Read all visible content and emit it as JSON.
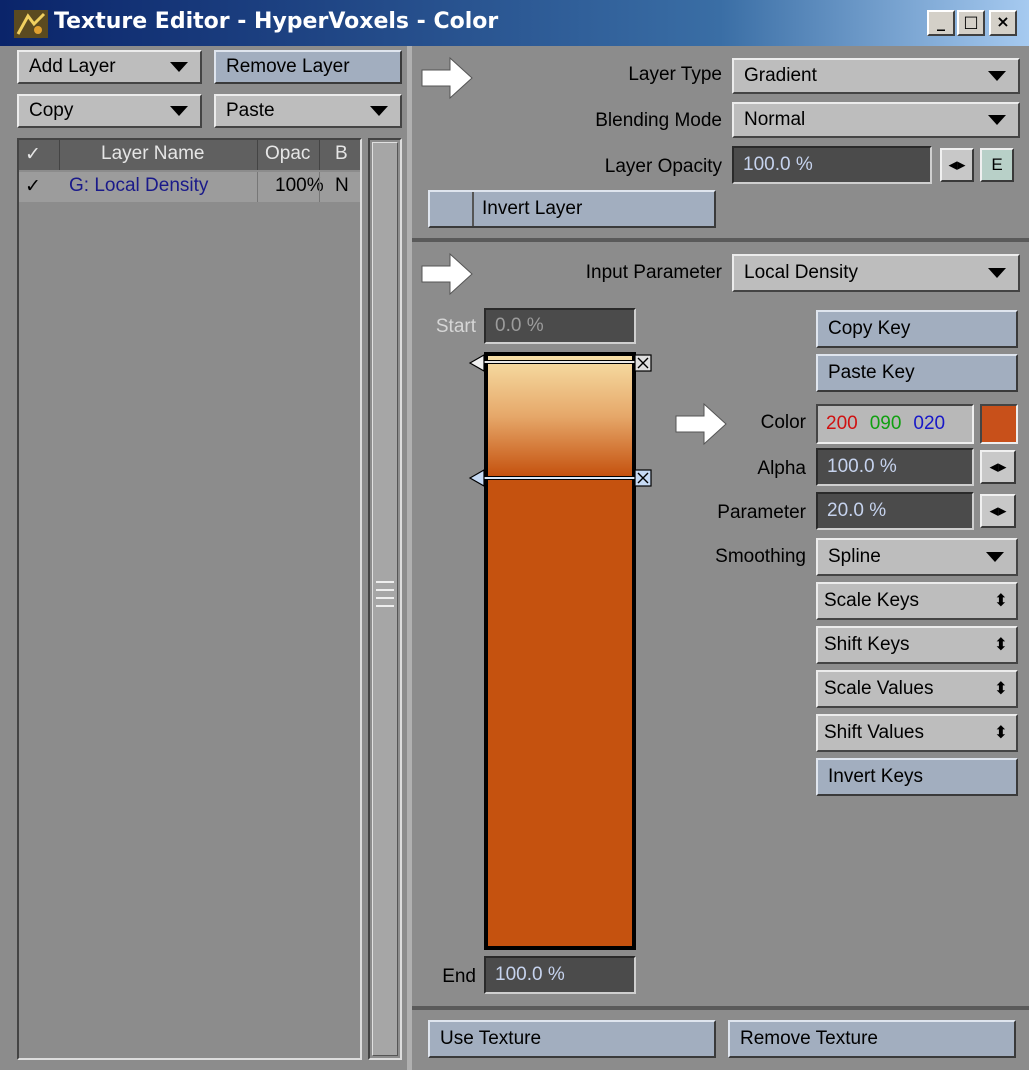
{
  "window": {
    "title": "Texture Editor - HyperVoxels - Color",
    "buttons": {
      "minimize": "_",
      "maximize": "□",
      "close": "×"
    }
  },
  "left": {
    "add_layer": "Add Layer",
    "remove_layer": "Remove Layer",
    "copy": "Copy",
    "paste": "Paste",
    "columns": {
      "check": "✓",
      "name": "Layer Name",
      "opacity": "Opac",
      "blend": "B"
    },
    "rows": [
      {
        "check": "✓",
        "name": "G: Local Density",
        "opacity": "100%",
        "blend": "N"
      }
    ]
  },
  "layer": {
    "type_label": "Layer Type",
    "type_value": "Gradient",
    "blend_label": "Blending Mode",
    "blend_value": "Normal",
    "opacity_label": "Layer Opacity",
    "opacity_value": "100.0 %",
    "env_button": "E",
    "invert_layer": "Invert Layer"
  },
  "gradient": {
    "input_label": "Input Parameter",
    "input_value": "Local Density",
    "start_label": "Start",
    "start_value": "0.0 %",
    "end_label": "End",
    "end_value": "100.0 %",
    "copy_key": "Copy Key",
    "paste_key": "Paste Key",
    "color_label": "Color",
    "color_r": "200",
    "color_g": "090",
    "color_b": "020",
    "swatch_color": "#c8501a",
    "alpha_label": "Alpha",
    "alpha_value": "100.0 %",
    "parameter_label": "Parameter",
    "parameter_value": "20.0 %",
    "smoothing_label": "Smoothing",
    "smoothing_value": "Spline",
    "scale_keys": "Scale Keys",
    "shift_keys": "Shift Keys",
    "scale_values": "Scale Values",
    "shift_values": "Shift Values",
    "invert_keys": "Invert Keys",
    "gradient_colors": {
      "top": "#f7dfa6",
      "bottom": "#c5520f"
    }
  },
  "footer": {
    "use_texture": "Use Texture",
    "remove_texture": "Remove Texture"
  }
}
